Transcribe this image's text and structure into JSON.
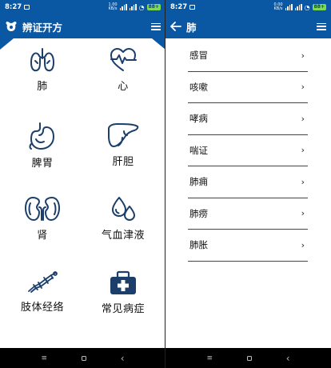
{
  "left": {
    "status": {
      "time": "8:27",
      "net_speed": "1.00\nKB/s",
      "battery": "88+"
    },
    "appbar": {
      "title": "辨证开方"
    },
    "tiles": [
      {
        "label": "肺",
        "icon": "lungs-icon"
      },
      {
        "label": "心",
        "icon": "heart-pulse-icon"
      },
      {
        "label": "脾胃",
        "icon": "stomach-icon"
      },
      {
        "label": "肝胆",
        "icon": "liver-icon"
      },
      {
        "label": "肾",
        "icon": "kidneys-icon"
      },
      {
        "label": "气血津液",
        "icon": "droplets-icon"
      },
      {
        "label": "肢体经络",
        "icon": "body-meridian-icon"
      },
      {
        "label": "常见病症",
        "icon": "medical-kit-icon"
      }
    ]
  },
  "right": {
    "status": {
      "time": "8:27",
      "net_speed": "0.00\nKB/s",
      "battery": "88+"
    },
    "appbar": {
      "title": "肺"
    },
    "items": [
      {
        "label": "感冒"
      },
      {
        "label": "咳嗽"
      },
      {
        "label": "哮病"
      },
      {
        "label": "喘证"
      },
      {
        "label": "肺痈"
      },
      {
        "label": "肺痨"
      },
      {
        "label": "肺胀"
      }
    ]
  },
  "navbar": {
    "menu": "≡",
    "back": "‹"
  },
  "colors": {
    "primary": "#0a57a3",
    "icon_stroke": "#1b3e6b"
  }
}
